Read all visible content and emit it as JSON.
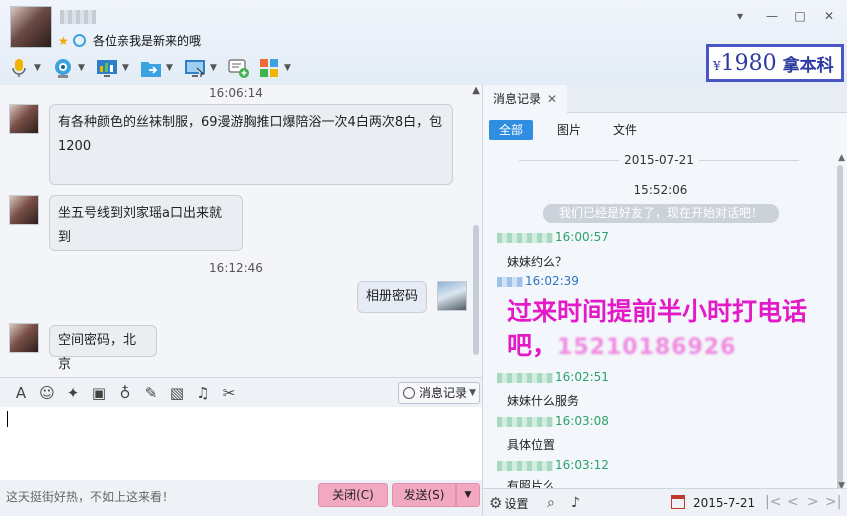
{
  "header": {
    "signature": "各位亲我是新来的哦",
    "window_controls": [
      "▾",
      "—",
      "□",
      "✕"
    ]
  },
  "toolbar": {
    "icons": [
      "microphone-icon",
      "webcam-icon",
      "screen-share-icon",
      "file-transfer-icon",
      "remote-desktop-icon",
      "invite-icon",
      "apps-icon"
    ]
  },
  "brand": {
    "yen": "¥",
    "price": "1980",
    "text": "拿本科"
  },
  "chat": {
    "messages": [
      {
        "type": "time",
        "text": "16:06:14"
      },
      {
        "type": "received",
        "text": "有各种颜色的丝袜制服，69漫游胸推口爆陪浴一次4白两次8白，包1200"
      },
      {
        "type": "received",
        "text": "坐五号线到刘家瑶a口出来就到"
      },
      {
        "type": "time",
        "text": "16:12:46"
      },
      {
        "type": "sent",
        "text": "相册密码"
      },
      {
        "type": "received",
        "text": "空间密码，北京"
      }
    ]
  },
  "input_toolbar": {
    "history_label": "消息记录"
  },
  "bottom": {
    "tip": "这天挺街好热，不如上这来看！",
    "close_label": "关闭(C)",
    "send_label": "发送(S)"
  },
  "history": {
    "tab_label": "消息记录",
    "tab_close": "✕",
    "filters": [
      "全部",
      "图片",
      "文件"
    ],
    "date": "2015-07-21",
    "first_time": "15:52:06",
    "system_msg": "我们已经是好友了，现在开始对话吧！",
    "entries": [
      {
        "time": "16:00:57",
        "side": "other",
        "text": "妹妹约么？"
      },
      {
        "time": "16:02:39",
        "side": "self",
        "text": ""
      },
      {
        "time": "16:02:51",
        "side": "other",
        "text": "妹妹什么服务"
      },
      {
        "time": "16:03:08",
        "side": "other",
        "text": "具体位置"
      },
      {
        "time": "16:03:12",
        "side": "other",
        "text": "有照片么"
      }
    ],
    "overlay_text": "过来时间提前半小时打电话吧，",
    "overlay_phone": "15210186926",
    "settings_label": "设置",
    "bottom_date": "2015-7-21"
  }
}
